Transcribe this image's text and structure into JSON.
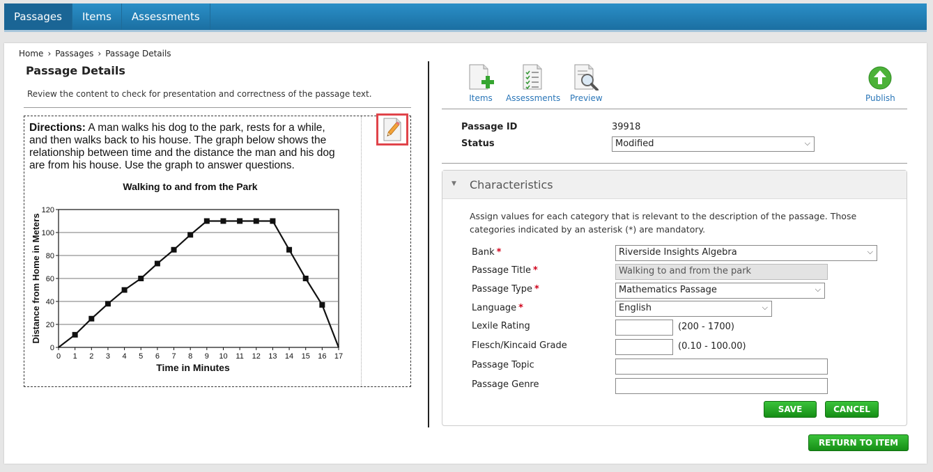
{
  "nav": {
    "tabs": [
      "Passages",
      "Items",
      "Assessments"
    ],
    "active": "Passages"
  },
  "breadcrumb": [
    "Home",
    "Passages",
    "Passage Details"
  ],
  "page": {
    "title": "Passage Details",
    "description": "Review the content to check for presentation and correctness of the passage text."
  },
  "passage": {
    "directions_label": "Directions:",
    "directions_text": " A man walks his dog to the park, rests for a while, and then walks back to his house. The graph below shows the relationship between time and the distance the man and his dog are from his house. Use the graph to answer questions."
  },
  "chart_data": {
    "type": "line",
    "title": "Walking to and from the Park",
    "xlabel": "Time in Minutes",
    "ylabel": "Distance from Home in Meters",
    "x": [
      0,
      1,
      2,
      3,
      4,
      5,
      6,
      7,
      8,
      9,
      10,
      11,
      12,
      13,
      14,
      15,
      16,
      17
    ],
    "y": [
      0,
      11,
      25,
      38,
      50,
      60,
      73,
      85,
      98,
      110,
      110,
      110,
      110,
      110,
      85,
      60,
      37,
      0
    ],
    "xlim": [
      0,
      17
    ],
    "ylim": [
      0,
      120
    ],
    "xticks": [
      0,
      1,
      2,
      3,
      4,
      5,
      6,
      7,
      8,
      9,
      10,
      11,
      12,
      13,
      14,
      15,
      16,
      17
    ],
    "yticks": [
      0,
      20,
      40,
      60,
      80,
      100,
      120
    ],
    "grid": "horizontal"
  },
  "toolbar": {
    "items_label": "Items",
    "assessments_label": "Assessments",
    "preview_label": "Preview",
    "publish_label": "Publish"
  },
  "info": {
    "passage_id_label": "Passage ID",
    "passage_id": "39918",
    "status_label": "Status",
    "status_value": "Modified"
  },
  "characteristics": {
    "title": "Characteristics",
    "description": "Assign values for each category that is relevant to the description of the passage. Those categories indicated by an asterisk (*) are mandatory.",
    "required_mark": "*",
    "bank_label": "Bank",
    "bank_value": "Riverside Insights Algebra",
    "title_label": "Passage Title",
    "title_value": "Walking to and from the park",
    "type_label": "Passage Type",
    "type_value": "Mathematics Passage",
    "language_label": "Language",
    "language_value": "English",
    "lexile_label": "Lexile Rating",
    "lexile_value": "",
    "lexile_range": "(200 - 1700)",
    "flesch_label": "Flesch/Kincaid Grade",
    "flesch_value": "",
    "flesch_range": "(0.10 - 100.00)",
    "topic_label": "Passage Topic",
    "topic_value": "",
    "genre_label": "Passage Genre",
    "genre_value": "",
    "save_label": "SAVE",
    "cancel_label": "CANCEL"
  },
  "return_label": "RETURN TO ITEM"
}
